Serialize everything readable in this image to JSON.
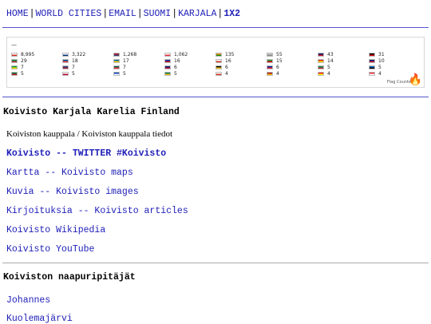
{
  "nav": {
    "items": [
      "HOME",
      "WORLD CITIES",
      "EMAIL",
      "SUOMI",
      "KARJALA",
      "1X2"
    ],
    "separator": "|"
  },
  "flag_counter": {
    "dash": "—",
    "label": "Flag Counter",
    "entries": [
      {
        "flag": [
          "#ffffff",
          "#d52b1e"
        ],
        "count": "8,995"
      },
      {
        "flag": [
          "#ffffff",
          "#003580"
        ],
        "count": "3,322"
      },
      {
        "flag": [
          "#b22234",
          "#3c3b6e"
        ],
        "count": "1,268"
      },
      {
        "flag": [
          "#ffffff",
          "#ed2939"
        ],
        "count": "1,062"
      },
      {
        "flag": [
          "#ff9933",
          "#138808"
        ],
        "count": "135"
      },
      {
        "flag": [
          "#cccccc",
          "#888888"
        ],
        "count": "55"
      },
      {
        "flag": [
          "#012169",
          "#c8102e"
        ],
        "count": "43"
      },
      {
        "flag": [
          "#000000",
          "#dd0000"
        ],
        "count": "31"
      },
      {
        "flag": [
          "#009246",
          "#ce2b37"
        ],
        "count": "29"
      },
      {
        "flag": [
          "#0055a4",
          "#ef4135"
        ],
        "count": "18"
      },
      {
        "flag": [
          "#006aa7",
          "#fecc00"
        ],
        "count": "17"
      },
      {
        "flag": [
          "#0038a8",
          "#ce1126"
        ],
        "count": "16"
      },
      {
        "flag": [
          "#ffffff",
          "#d52b1e"
        ],
        "count": "16"
      },
      {
        "flag": [
          "#239f40",
          "#da0000"
        ],
        "count": "15"
      },
      {
        "flag": [
          "#de2910",
          "#ffde00"
        ],
        "count": "14"
      },
      {
        "flag": [
          "#00247d",
          "#cc142b"
        ],
        "count": "10"
      },
      {
        "flag": [
          "#009c3b",
          "#ffdf00"
        ],
        "count": "7"
      },
      {
        "flag": [
          "#21468b",
          "#ae1c28"
        ],
        "count": "7"
      },
      {
        "flag": [
          "#006a4e",
          "#f42a41"
        ],
        "count": "7"
      },
      {
        "flag": [
          "#00247d",
          "#cc142b"
        ],
        "count": "6"
      },
      {
        "flag": [
          "#000000",
          "#ffce00"
        ],
        "count": "6"
      },
      {
        "flag": [
          "#002395",
          "#ed2939"
        ],
        "count": "6"
      },
      {
        "flag": [
          "#009246",
          "#ce2b37"
        ],
        "count": "5"
      },
      {
        "flag": [
          "#0072ce",
          "#000000"
        ],
        "count": "5"
      },
      {
        "flag": [
          "#007a3d",
          "#ce1126"
        ],
        "count": "5"
      },
      {
        "flag": [
          "#ffffff",
          "#bc002d"
        ],
        "count": "5"
      },
      {
        "flag": [
          "#0038b8",
          "#ffffff"
        ],
        "count": "5"
      },
      {
        "flag": [
          "#007749",
          "#ffb81c"
        ],
        "count": "5"
      },
      {
        "flag": [
          "#ffffff",
          "#d52b1e"
        ],
        "count": "4"
      },
      {
        "flag": [
          "#aa151b",
          "#f1bf00"
        ],
        "count": "4"
      },
      {
        "flag": [
          "#ee1c25",
          "#ffff00"
        ],
        "count": "4"
      },
      {
        "flag": [
          "#ed2939",
          "#ffffff"
        ],
        "count": "4"
      }
    ]
  },
  "section1": {
    "title": "Koivisto Karjala Karelia Finland",
    "subtitle": "Koiviston kauppala / Koiviston kauppala tiedot",
    "links": [
      {
        "label": "Koivisto -- TWITTER #Koivisto",
        "bold": true
      },
      {
        "label": "Kartta -- Koivisto maps",
        "bold": false
      },
      {
        "label": "Kuvia -- Koivisto images",
        "bold": false
      },
      {
        "label": "Kirjoituksia -- Koivisto articles",
        "bold": false
      },
      {
        "label": "Koivisto Wikipedia",
        "bold": false
      },
      {
        "label": "Koivisto YouTube",
        "bold": false
      }
    ]
  },
  "section2": {
    "title": "Koiviston naapuripitäjät",
    "links": [
      "Johannes",
      "Kuolemajärvi"
    ]
  }
}
